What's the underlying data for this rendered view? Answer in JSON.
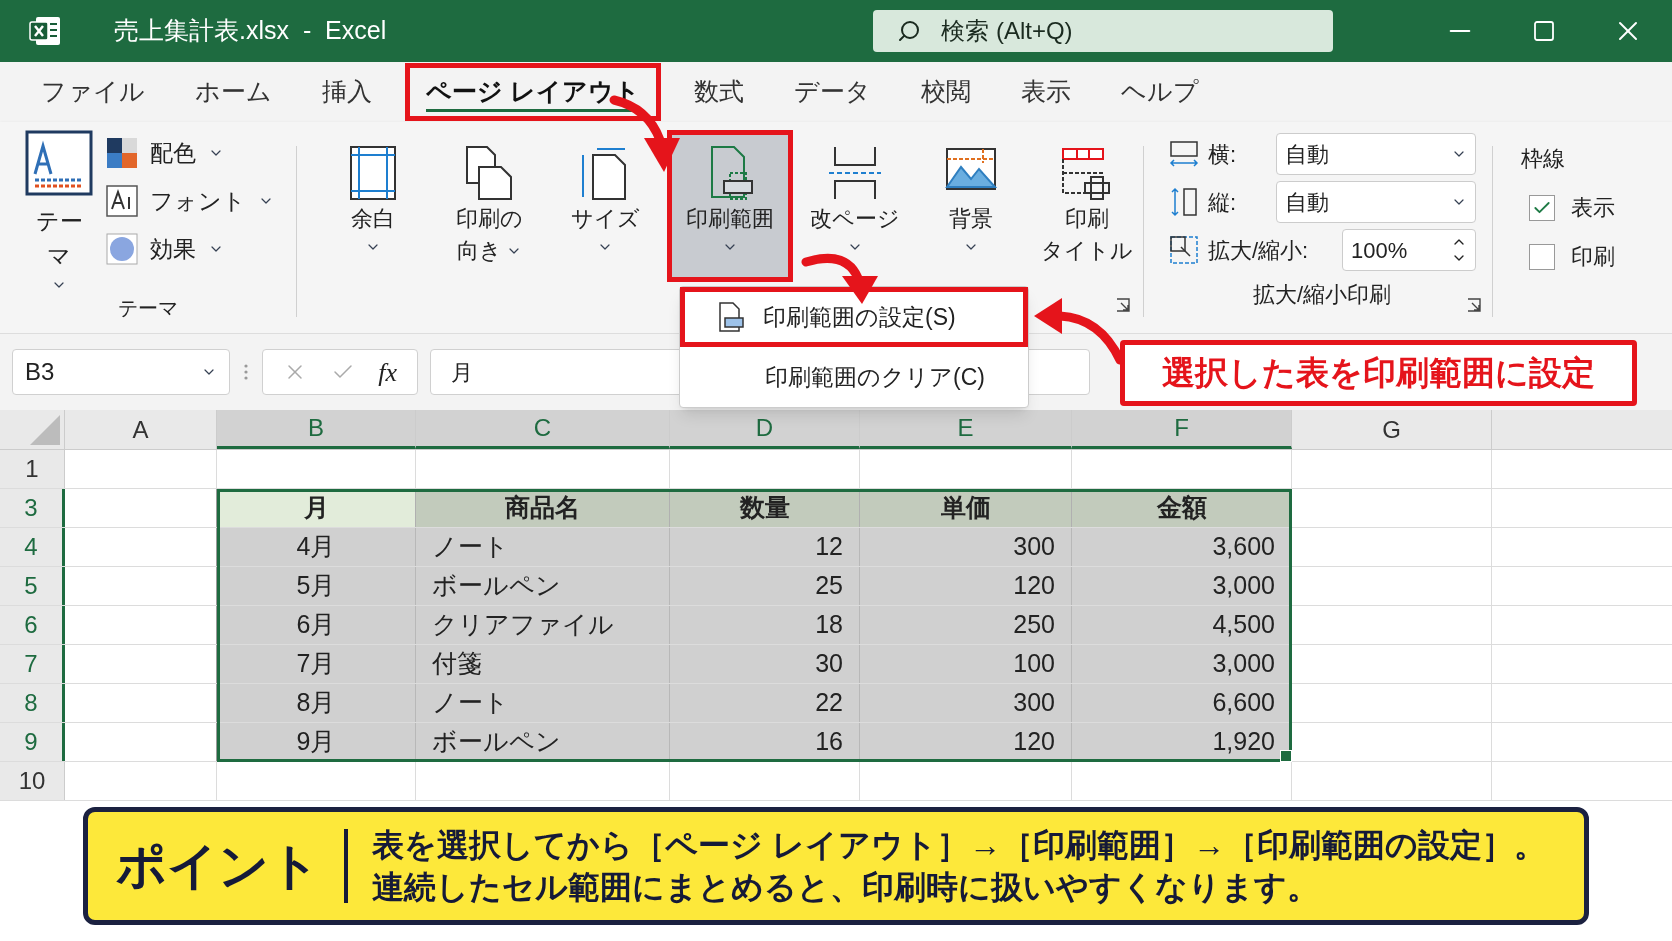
{
  "title_bar": {
    "title": "売上集計表.xlsx  -  Excel",
    "search": {
      "placeholder": "検索 (Alt+Q)"
    }
  },
  "menu_tabs": [
    {
      "label": "ファイル",
      "selected": false,
      "highlighted": false
    },
    {
      "label": "ホーム",
      "selected": false,
      "highlighted": false
    },
    {
      "label": "挿入",
      "selected": false,
      "highlighted": false
    },
    {
      "label": "ページ レイアウト",
      "selected": true,
      "highlighted": true
    },
    {
      "label": "数式",
      "selected": false,
      "highlighted": false
    },
    {
      "label": "データ",
      "selected": false,
      "highlighted": false
    },
    {
      "label": "校閲",
      "selected": false,
      "highlighted": false
    },
    {
      "label": "表示",
      "selected": false,
      "highlighted": false
    },
    {
      "label": "ヘルプ",
      "selected": false,
      "highlighted": false
    }
  ],
  "ribbon": {
    "theme_group": {
      "big_button": "テーマ",
      "items": [
        {
          "kind": "colors",
          "label": "配色"
        },
        {
          "kind": "fonts",
          "label": "フォント"
        },
        {
          "kind": "effects",
          "label": "効果"
        }
      ],
      "label": "テーマ"
    },
    "page_setup_buttons": [
      {
        "kind": "margins",
        "lines": [
          "余白"
        ],
        "pressed": false,
        "highlighted": false
      },
      {
        "kind": "orientation",
        "lines": [
          "印刷の",
          "向き"
        ],
        "pressed": false,
        "highlighted": false
      },
      {
        "kind": "size",
        "lines": [
          "サイズ"
        ],
        "pressed": false,
        "highlighted": false
      },
      {
        "kind": "print_area",
        "lines": [
          "印刷範囲"
        ],
        "pressed": true,
        "highlighted": true
      },
      {
        "kind": "breaks",
        "lines": [
          "改ページ"
        ],
        "pressed": false,
        "highlighted": false
      },
      {
        "kind": "background",
        "lines": [
          "背景"
        ],
        "pressed": false,
        "highlighted": false
      },
      {
        "kind": "titles",
        "lines": [
          "印刷",
          "タイトル"
        ],
        "pressed": false,
        "highlighted": false
      }
    ],
    "scale_group": {
      "width": {
        "label": "横:",
        "value": "自動"
      },
      "height": {
        "label": "縦:",
        "value": "自動"
      },
      "scale": {
        "label": "拡大/縮小:",
        "value": "100%"
      },
      "label": "拡大/縮小印刷"
    },
    "gridlines_group": {
      "title": "枠線",
      "options": [
        {
          "label": "表示",
          "checked": true
        },
        {
          "label": "印刷",
          "checked": false
        }
      ]
    }
  },
  "print_area_menu": [
    {
      "label": "印刷範囲の設定(S)",
      "highlighted": true
    },
    {
      "label": "印刷範囲のクリア(C)",
      "highlighted": false
    }
  ],
  "formula_bar": {
    "name_box": "B3",
    "fx": "fx",
    "value": "月"
  },
  "callout": "選択した表を印刷範囲に設定",
  "sheet": {
    "columns": [
      {
        "label": "A",
        "selected": false
      },
      {
        "label": "B",
        "selected": true
      },
      {
        "label": "C",
        "selected": true
      },
      {
        "label": "D",
        "selected": true
      },
      {
        "label": "E",
        "selected": true
      },
      {
        "label": "F",
        "selected": true
      },
      {
        "label": "G",
        "selected": false
      }
    ],
    "rows": [
      {
        "label": "1",
        "selected": false
      },
      {
        "label": "3",
        "selected": true
      },
      {
        "label": "4",
        "selected": true
      },
      {
        "label": "5",
        "selected": true
      },
      {
        "label": "6",
        "selected": true
      },
      {
        "label": "7",
        "selected": true
      },
      {
        "label": "8",
        "selected": true
      },
      {
        "label": "9",
        "selected": true
      },
      {
        "label": "10",
        "selected": false
      }
    ],
    "table": {
      "columns": [
        {
          "header": "月",
          "kind": "label",
          "active": true
        },
        {
          "header": "商品名",
          "kind": "text",
          "active": false
        },
        {
          "header": "数量",
          "kind": "number",
          "active": false
        },
        {
          "header": "単価",
          "kind": "number",
          "active": false
        },
        {
          "header": "金額",
          "kind": "number",
          "active": false
        }
      ],
      "rows": [
        [
          "4月",
          "ノート",
          "12",
          "300",
          "3,600"
        ],
        [
          "5月",
          "ボールペン",
          "25",
          "120",
          "3,000"
        ],
        [
          "6月",
          "クリアファイル",
          "18",
          "250",
          "4,500"
        ],
        [
          "7月",
          "付箋",
          "30",
          "100",
          "3,000"
        ],
        [
          "8月",
          "ノート",
          "22",
          "300",
          "6,600"
        ],
        [
          "9月",
          "ボールペン",
          "16",
          "120",
          "1,920"
        ]
      ]
    }
  },
  "point_banner": {
    "label": "ポイント",
    "lines": [
      "表を選択してから［ページ レイアウト］→［印刷範囲］→［印刷範囲の設定］。",
      "連続したセル範囲にまとめると、印刷時に扱いやすくなります。"
    ]
  }
}
